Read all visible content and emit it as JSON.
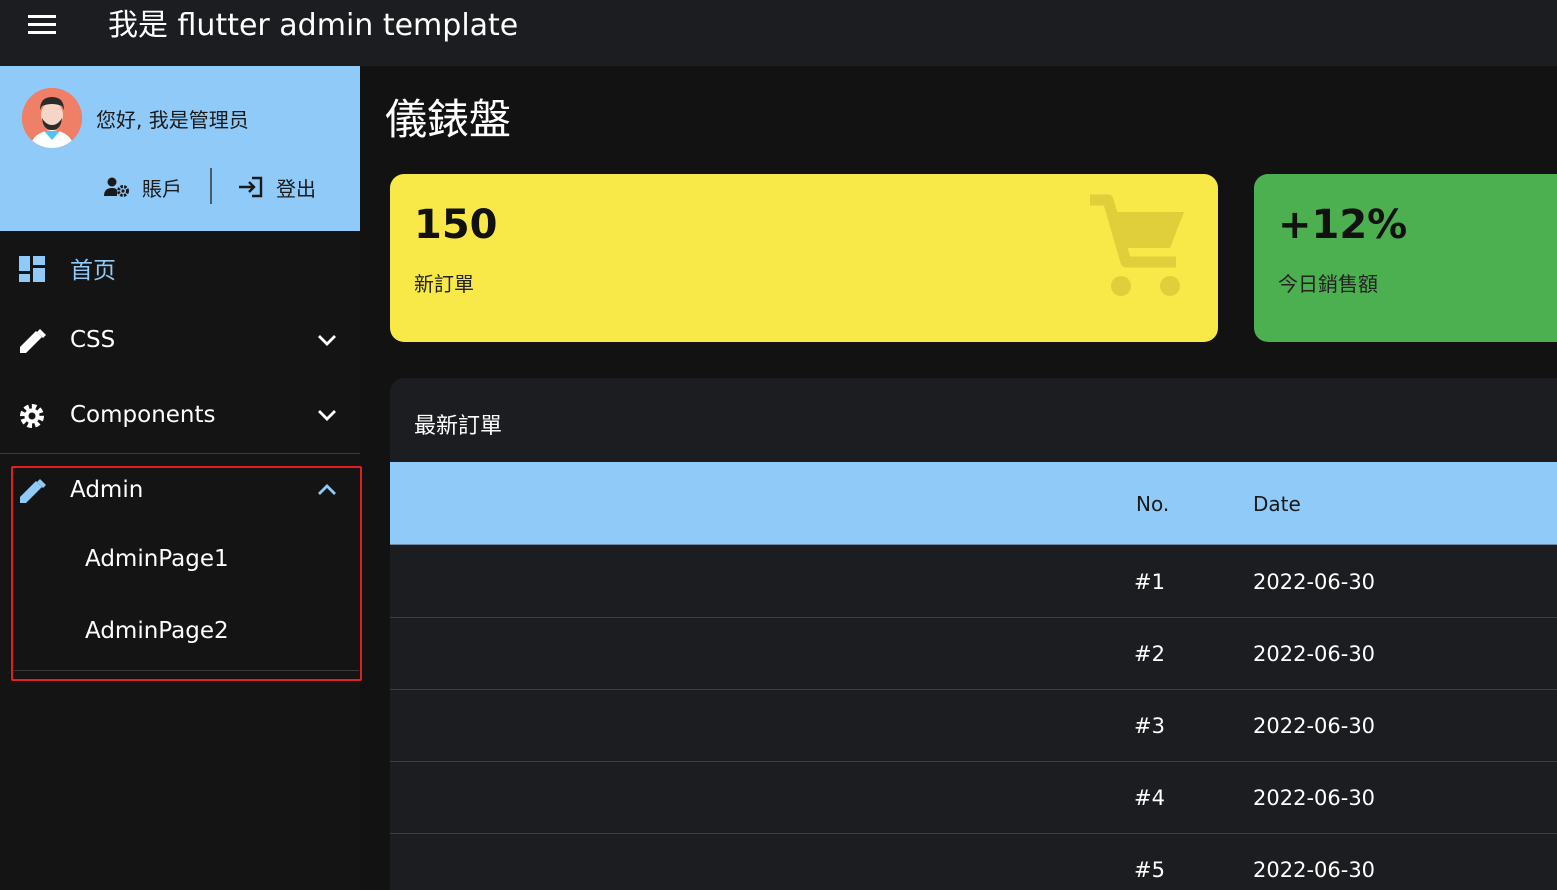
{
  "appbar": {
    "title": "我是 flutter admin template",
    "menu_icon": "menu-icon"
  },
  "sidebar": {
    "greeting": "您好, 我是管理员",
    "account_label": "賬戶",
    "logout_label": "登出",
    "items": [
      {
        "label": "首页",
        "icon": "dashboard-icon",
        "active": true
      },
      {
        "label": "CSS",
        "icon": "pencil-icon",
        "expanded": false
      },
      {
        "label": "Components",
        "icon": "gear-icon",
        "expanded": false
      },
      {
        "label": "Admin",
        "icon": "pencil-icon",
        "expanded": true,
        "children": [
          {
            "label": "AdminPage1"
          },
          {
            "label": "AdminPage2"
          }
        ]
      }
    ],
    "colors": {
      "header_bg": "#90caf9",
      "active_item": "#90caf9",
      "highlight_border": "#e02020"
    }
  },
  "main": {
    "page_title": "儀錶盤",
    "stats": [
      {
        "value": "150",
        "label": "新訂單",
        "color": "#f8e948",
        "icon": "cart-icon"
      },
      {
        "value": "+12%",
        "label": "今日銷售額",
        "color": "#4caf50"
      }
    ],
    "orders": {
      "title": "最新訂單",
      "columns": {
        "no": "No.",
        "date": "Date"
      },
      "rows": [
        {
          "no": "#1",
          "date": "2022-06-30"
        },
        {
          "no": "#2",
          "date": "2022-06-30"
        },
        {
          "no": "#3",
          "date": "2022-06-30"
        },
        {
          "no": "#4",
          "date": "2022-06-30"
        },
        {
          "no": "#5",
          "date": "2022-06-30"
        }
      ]
    }
  }
}
